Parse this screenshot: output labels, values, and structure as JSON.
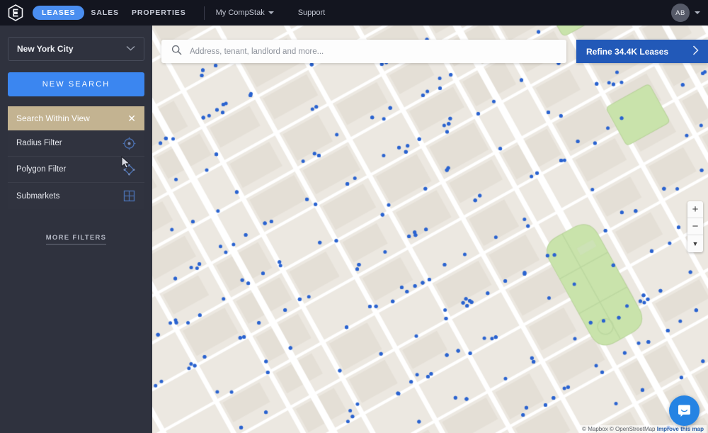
{
  "header": {
    "logo_icon": "compstak-hexagon-logo",
    "tabs": [
      {
        "label": "LEASES",
        "active": true
      },
      {
        "label": "SALES",
        "active": false
      },
      {
        "label": "PROPERTIES",
        "active": false
      }
    ],
    "links": [
      {
        "label": "My CompStak",
        "has_caret": true
      },
      {
        "label": "Support",
        "has_caret": false
      }
    ],
    "avatar_initials": "AB",
    "avatar_caret_icon": "chevron-down-icon"
  },
  "sidebar": {
    "city_select": {
      "value": "New York City",
      "caret_icon": "chevron-down-icon"
    },
    "new_search_label": "NEW SEARCH",
    "search_within_view": {
      "label": "Search Within View",
      "close_icon": "close-icon"
    },
    "filters": [
      {
        "label": "Radius Filter",
        "icon": "radius-circle-icon"
      },
      {
        "label": "Polygon Filter",
        "icon": "polygon-diamond-icon"
      },
      {
        "label": "Submarkets",
        "icon": "grid-icon"
      }
    ],
    "more_filters_label": "MORE FILTERS"
  },
  "map": {
    "search": {
      "placeholder": "Address, tenant, landlord and more...",
      "value": "",
      "icon": "search-icon"
    },
    "refine": {
      "label": "Refine 34.4K Leases",
      "arrow_icon": "chevron-right-icon"
    },
    "zoom_controls": [
      {
        "label": "+",
        "name": "zoom-in"
      },
      {
        "label": "−",
        "name": "zoom-out"
      },
      {
        "label": "▼",
        "name": "compass-reset"
      }
    ],
    "chat_icon": "chat-bubble-icon",
    "attribution": {
      "copyright": "© Mapbox © OpenStreetMap",
      "improve_link": "Improve this map"
    },
    "colors": {
      "land": "#ece8e1",
      "road": "#ffffff",
      "park": "#c9e3ab",
      "marker": "#2a63d0",
      "accent_blue": "#3b86f0",
      "refine_blue": "#2259b8",
      "tan": "#c3b391",
      "sidebar": "#2f323e",
      "header": "#13151f"
    },
    "marker_count_label": "34.4K"
  }
}
